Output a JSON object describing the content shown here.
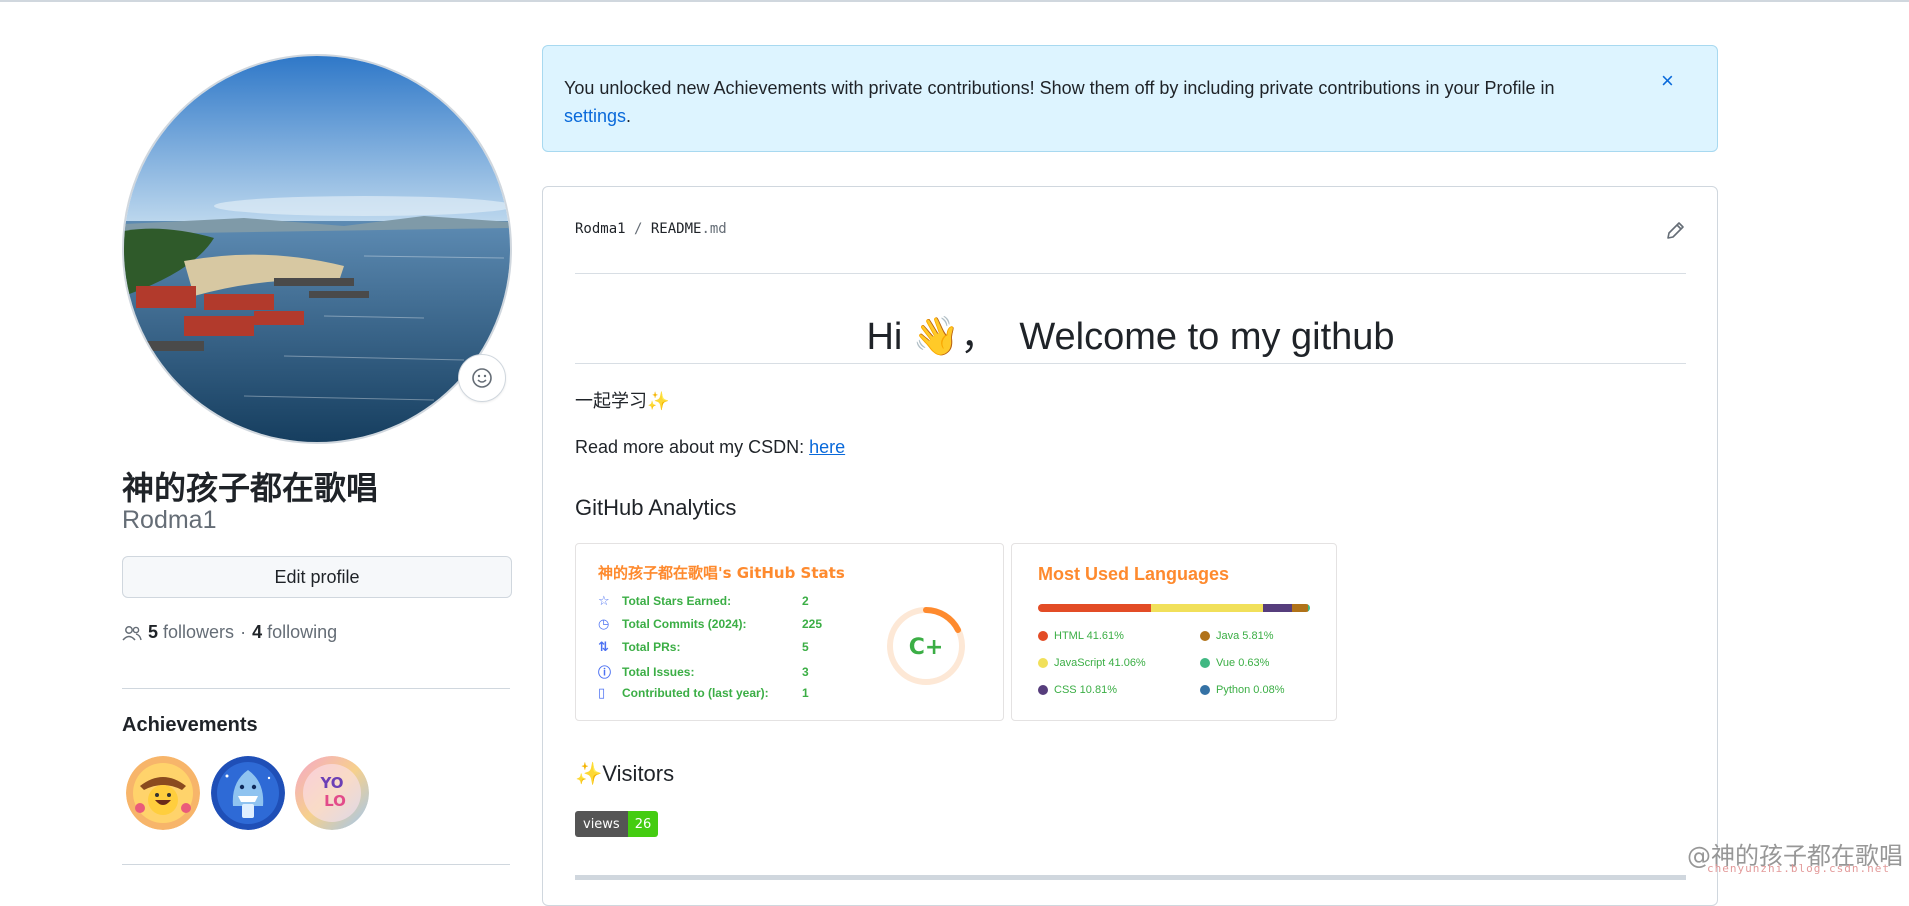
{
  "profile": {
    "display_name": "神的孩子都在歌唱",
    "username": "Rodma1",
    "edit_profile_label": "Edit profile",
    "followers_count": "5",
    "followers_label": "followers",
    "following_count": "4",
    "following_label": "following",
    "separator": "·",
    "achievements_title": "Achievements",
    "achievements": [
      "cowboy-achievement-badge",
      "shark-achievement-badge",
      "yolo-achievement-badge"
    ]
  },
  "flash": {
    "message": "You unlocked new Achievements with private contributions! Show them off by including private contributions in your Profile in",
    "link_text": "settings",
    "trailing": ".",
    "close_icon": "×"
  },
  "readme": {
    "owner": "Rodma1",
    "sep": " / ",
    "file_base": "README",
    "file_ext": ".md",
    "title_pre": "Hi 👋，",
    "title_post": "Welcome to my github",
    "line1": "一起学习✨",
    "line2_text": "Read more about my CSDN: ",
    "line2_link": "here",
    "analytics_heading": "GitHub Analytics",
    "visitors_heading": "✨Visitors",
    "views_label": "views",
    "views_count": "26"
  },
  "stats_card": {
    "title": "神的孩子都在歌唱's GitHub Stats",
    "grade": "C+",
    "rows": [
      {
        "icon": "star-icon",
        "label": "Total Stars Earned:",
        "value": "2"
      },
      {
        "icon": "history-icon",
        "label": "Total Commits (2024):",
        "value": "225"
      },
      {
        "icon": "pull-request-icon",
        "label": "Total PRs:",
        "value": "5"
      },
      {
        "icon": "issue-icon",
        "label": "Total Issues:",
        "value": "3"
      },
      {
        "icon": "repo-icon",
        "label": "Contributed to (last year):",
        "value": "1"
      }
    ]
  },
  "languages_card": {
    "title": "Most Used Languages",
    "items": [
      {
        "name": "HTML 41.61%",
        "color": "#e34c26",
        "pct": 41.61
      },
      {
        "name": "JavaScript 41.06%",
        "color": "#f1e05a",
        "pct": 41.06
      },
      {
        "name": "CSS 10.81%",
        "color": "#563d7c",
        "pct": 10.81
      },
      {
        "name": "Java 5.81%",
        "color": "#b07219",
        "pct": 5.81
      },
      {
        "name": "Vue 0.63%",
        "color": "#41b883",
        "pct": 0.63
      },
      {
        "name": "Python 0.08%",
        "color": "#3572a5",
        "pct": 0.08
      }
    ]
  },
  "watermark": {
    "main": "@神的孩子都在歌唱",
    "sub": "chenyunzhi.blog.csdn.net"
  }
}
